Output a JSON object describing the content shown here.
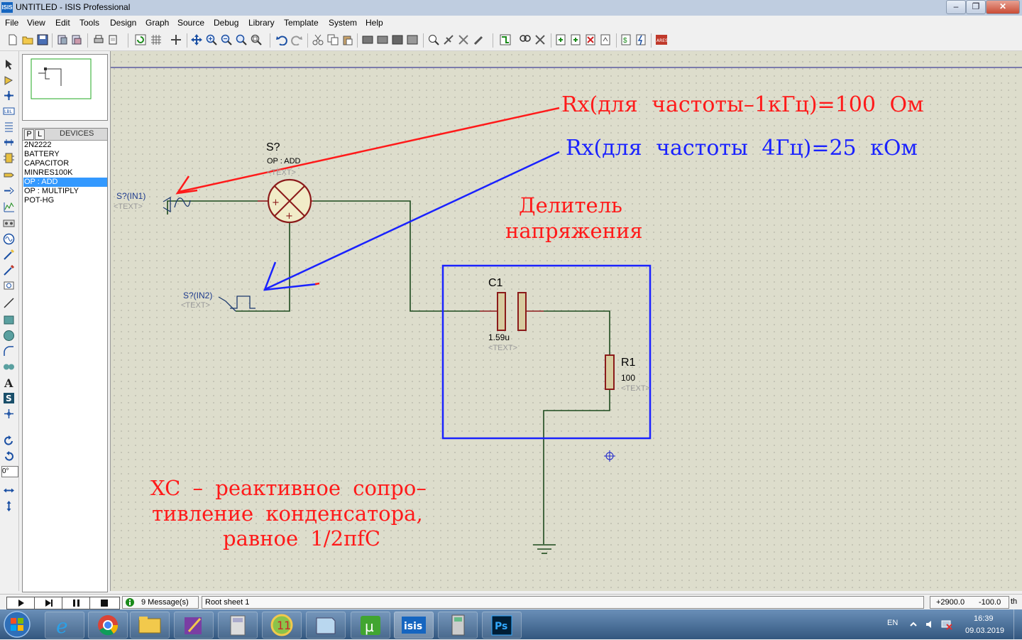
{
  "window": {
    "title": "UNTITLED - ISIS Professional",
    "logo": "ISIS"
  },
  "menu": [
    "File",
    "View",
    "Edit",
    "Tools",
    "Design",
    "Graph",
    "Source",
    "Debug",
    "Library",
    "Template",
    "System",
    "Help"
  ],
  "devices": {
    "tab_p": "P",
    "tab_l": "L",
    "header": "DEVICES",
    "items": [
      "2N2222",
      "BATTERY",
      "CAPACITOR",
      "MINRES100K",
      "OP : ADD",
      "OP : MULTIPLY",
      "POT-HG"
    ],
    "selected_index": 4
  },
  "rotation_field": "0°",
  "schematic": {
    "adder_ref": "S?",
    "adder_value": "OP : ADD",
    "adder_text": "<TEXT>",
    "in1_label": "S?(IN1)",
    "in1_text": "<TEXT>",
    "in2_label": "S?(IN2)",
    "in2_text": "<TEXT>",
    "c1_ref": "C1",
    "c1_value": "1.59u",
    "c1_text": "<TEXT>",
    "r1_ref": "R1",
    "r1_value": "100",
    "r1_text": "<TEXT>"
  },
  "annotations": {
    "red_note": "Rx(для частоты–1кГц)=100 Ом",
    "blue_note": "Rx(для частоты 4Гц)=25 кОм",
    "divider_line1": "Делитель",
    "divider_line2": "напряжения",
    "xc_line1": "XC – реактивное сопро–",
    "xc_line2": "тивление конденсатора,",
    "xc_line3": "равное 1/2πfC",
    "colors": {
      "red": "#ff1a1a",
      "blue": "#1a22ff"
    }
  },
  "status": {
    "messages": "9 Message(s)",
    "sheet": "Root sheet 1",
    "x": "+2900.0",
    "y": "-100.0",
    "unit": "th"
  },
  "taskbar": {
    "lang": "EN",
    "time": "16:39",
    "date": "09.03.2019"
  }
}
